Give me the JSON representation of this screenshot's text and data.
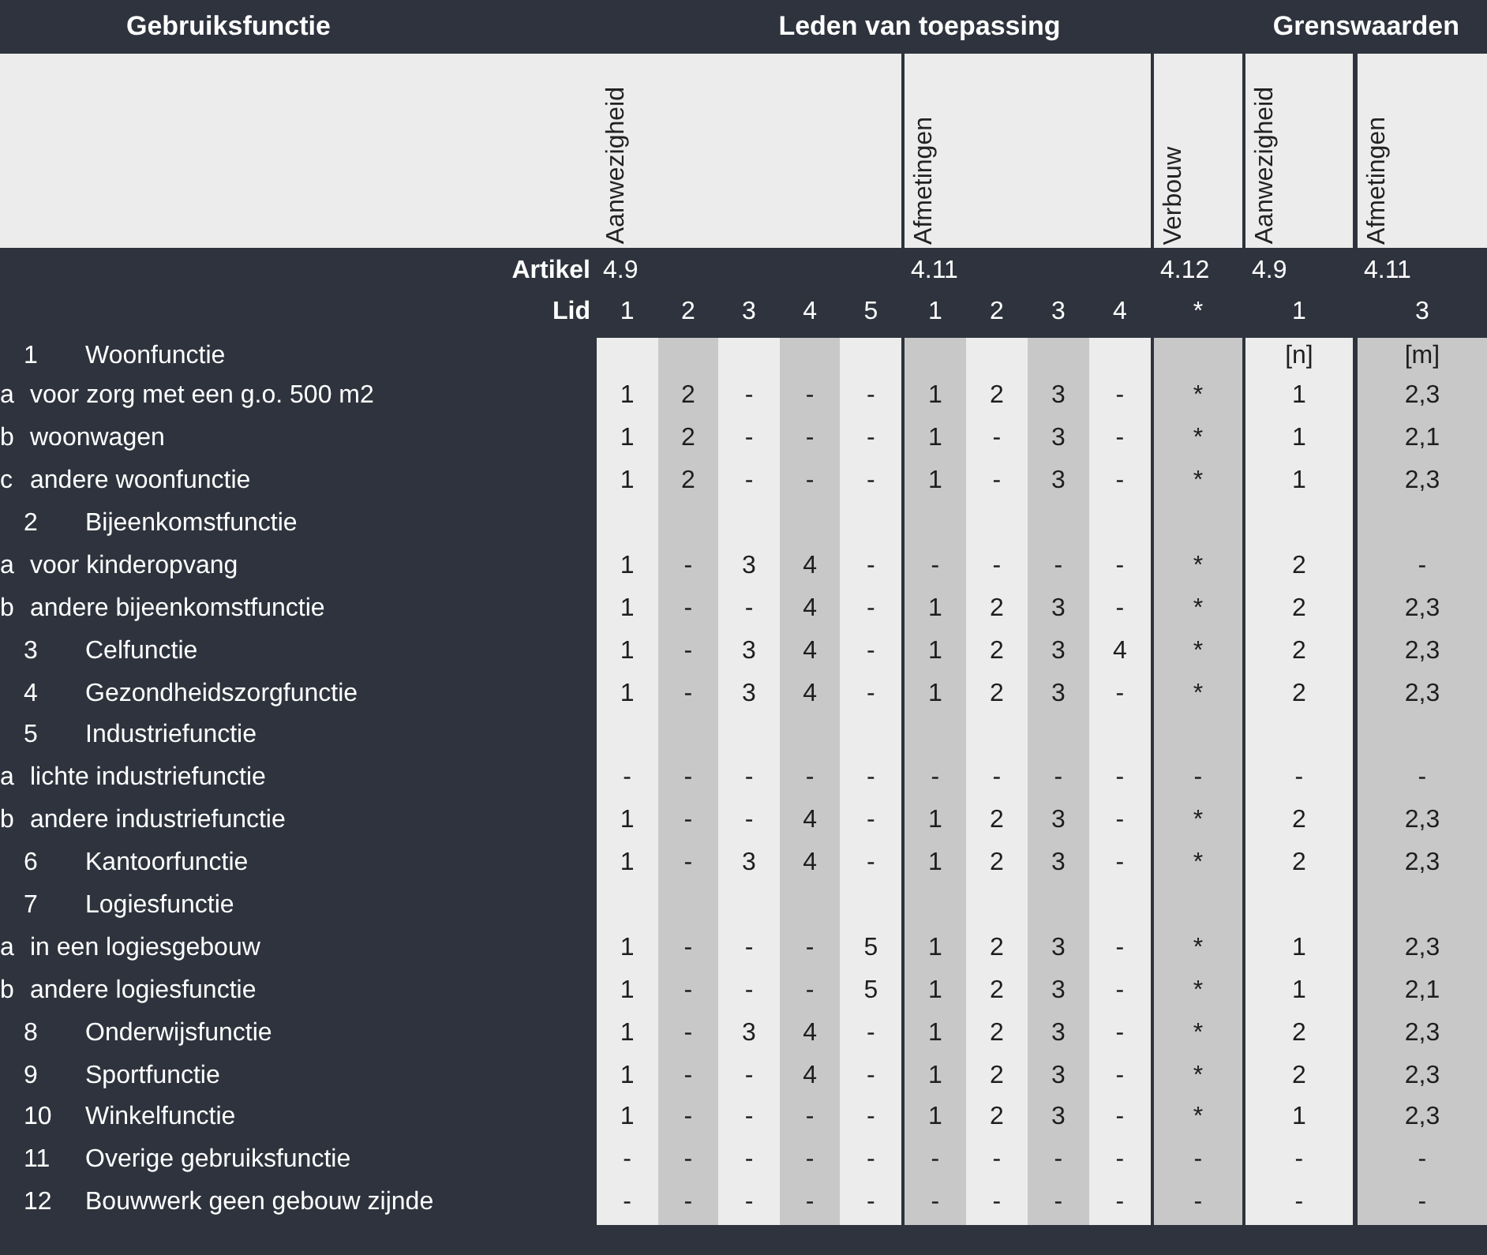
{
  "header": {
    "title": "Gebruiksfunctie"
  },
  "artikel_label": "Artikel",
  "lid_label": "Lid",
  "sections": [
    {
      "title": "Leden van toepassing",
      "columns": [
        {
          "label": "Aanwezigheid",
          "artikel": "4.9",
          "lid": [
            "1",
            "2",
            "3",
            "4",
            "5"
          ]
        },
        {
          "label": "Afmetingen",
          "artikel": "4.11",
          "lid": [
            "1",
            "2",
            "3",
            "4"
          ]
        },
        {
          "label": "Verbouw",
          "artikel": "4.12",
          "lid": [
            "*"
          ]
        }
      ]
    },
    {
      "title": "Grenswaarden",
      "columns": [
        {
          "label": "Aanwezigheid",
          "artikel": "4.9",
          "lid": [
            "1"
          ]
        },
        {
          "label": "Afmetingen",
          "artikel": "4.11",
          "lid": [
            "3"
          ]
        }
      ]
    }
  ],
  "rows": [
    {
      "number": "1",
      "name": "Woonfunctie",
      "cells": [
        null,
        null,
        null,
        null,
        null,
        null,
        null,
        null,
        null,
        null,
        "[n]",
        "[m]"
      ],
      "children": [
        {
          "letter": "a",
          "name": "voor zorg met een g.o. 500 m2",
          "cells": [
            "1",
            "2",
            "-",
            "-",
            "-",
            "1",
            "2",
            "3",
            "-",
            "*",
            "1",
            "2,3"
          ]
        },
        {
          "letter": "b",
          "name": "woonwagen",
          "cells": [
            "1",
            "2",
            "-",
            "-",
            "-",
            "1",
            "-",
            "3",
            "-",
            "*",
            "1",
            "2,1"
          ]
        },
        {
          "letter": "c",
          "name": "andere woonfunctie",
          "cells": [
            "1",
            "2",
            "-",
            "-",
            "-",
            "1",
            "-",
            "3",
            "-",
            "*",
            "1",
            "2,3"
          ]
        }
      ]
    },
    {
      "number": "2",
      "name": "Bijeenkomstfunctie",
      "children": [
        {
          "letter": "a",
          "name": "voor kinderopvang",
          "cells": [
            "1",
            "-",
            "3",
            "4",
            "-",
            "-",
            "-",
            "-",
            "-",
            "*",
            "2",
            "-"
          ]
        },
        {
          "letter": "b",
          "name": "andere bijeenkomstfunctie",
          "cells": [
            "1",
            "-",
            "-",
            "4",
            "-",
            "1",
            "2",
            "3",
            "-",
            "*",
            "2",
            "2,3"
          ]
        }
      ]
    },
    {
      "number": "3",
      "name": "Celfunctie",
      "cells": [
        "1",
        "-",
        "3",
        "4",
        "-",
        "1",
        "2",
        "3",
        "4",
        "*",
        "2",
        "2,3"
      ]
    },
    {
      "number": "4",
      "name": "Gezondheidszorgfunctie",
      "cells": [
        "1",
        "-",
        "3",
        "4",
        "-",
        "1",
        "2",
        "3",
        "-",
        "*",
        "2",
        "2,3"
      ]
    },
    {
      "number": "5",
      "name": "Industriefunctie",
      "children": [
        {
          "letter": "a",
          "name": "lichte industriefunctie",
          "cells": [
            "-",
            "-",
            "-",
            "-",
            "-",
            "-",
            "-",
            "-",
            "-",
            "-",
            "-",
            "-"
          ]
        },
        {
          "letter": "b",
          "name": "andere industriefunctie",
          "cells": [
            "1",
            "-",
            "-",
            "4",
            "-",
            "1",
            "2",
            "3",
            "-",
            "*",
            "2",
            "2,3"
          ]
        }
      ]
    },
    {
      "number": "6",
      "name": "Kantoorfunctie",
      "cells": [
        "1",
        "-",
        "3",
        "4",
        "-",
        "1",
        "2",
        "3",
        "-",
        "*",
        "2",
        "2,3"
      ]
    },
    {
      "number": "7",
      "name": "Logiesfunctie",
      "children": [
        {
          "letter": "a",
          "name": "in een logiesgebouw",
          "cells": [
            "1",
            "-",
            "-",
            "-",
            "5",
            "1",
            "2",
            "3",
            "-",
            "*",
            "1",
            "2,3"
          ]
        },
        {
          "letter": "b",
          "name": "andere logiesfunctie",
          "cells": [
            "1",
            "-",
            "-",
            "-",
            "5",
            "1",
            "2",
            "3",
            "-",
            "*",
            "1",
            "2,1"
          ]
        }
      ]
    },
    {
      "number": "8",
      "name": "Onderwijsfunctie",
      "cells": [
        "1",
        "-",
        "3",
        "4",
        "-",
        "1",
        "2",
        "3",
        "-",
        "*",
        "2",
        "2,3"
      ]
    },
    {
      "number": "9",
      "name": "Sportfunctie",
      "cells": [
        "1",
        "-",
        "-",
        "4",
        "-",
        "1",
        "2",
        "3",
        "-",
        "*",
        "2",
        "2,3"
      ]
    },
    {
      "number": "10",
      "name": "Winkelfunctie",
      "cells": [
        "1",
        "-",
        "-",
        "-",
        "-",
        "1",
        "2",
        "3",
        "-",
        "*",
        "1",
        "2,3"
      ]
    },
    {
      "number": "11",
      "name": "Overige gebruiksfunctie",
      "cells": [
        "-",
        "-",
        "-",
        "-",
        "-",
        "-",
        "-",
        "-",
        "-",
        "-",
        "-",
        "-"
      ]
    },
    {
      "number": "12",
      "name": "Bouwwerk geen gebouw zijnde",
      "cells": [
        "-",
        "-",
        "-",
        "-",
        "-",
        "-",
        "-",
        "-",
        "-",
        "-",
        "-",
        "-"
      ]
    }
  ]
}
